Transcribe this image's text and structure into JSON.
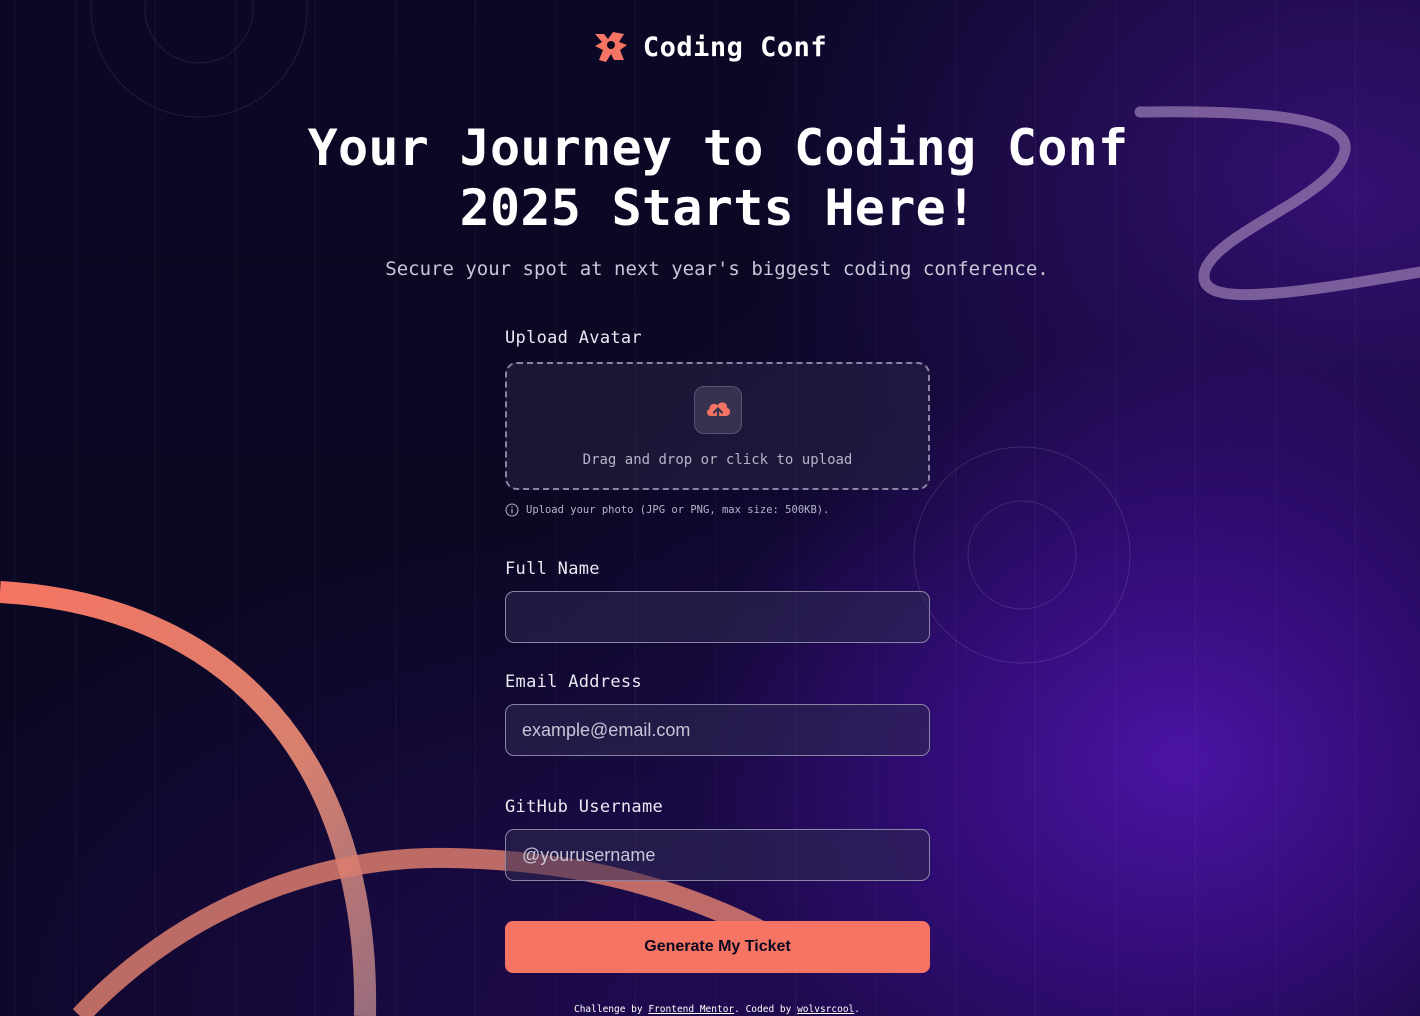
{
  "brand": {
    "name": "Coding Conf"
  },
  "hero": {
    "title": "Your Journey to Coding Conf 2025 Starts Here!",
    "subtitle": "Secure your spot at next year's biggest coding conference."
  },
  "form": {
    "avatar": {
      "label": "Upload Avatar",
      "dropzone_text": "Drag and drop or click to upload",
      "hint": "Upload your photo (JPG or PNG, max size: 500KB)."
    },
    "full_name": {
      "label": "Full Name",
      "value": "",
      "placeholder": ""
    },
    "email": {
      "label": "Email Address",
      "value": "",
      "placeholder": "example@email.com"
    },
    "github": {
      "label": "GitHub Username",
      "value": "",
      "placeholder": "@yourusername"
    },
    "submit_label": "Generate My Ticket"
  },
  "footer": {
    "prefix": "Challenge by ",
    "link1": "Frontend Mentor",
    "middle": ". Coded by ",
    "link2": "wolvsrcool",
    "suffix": "."
  },
  "colors": {
    "accent": "#f57463",
    "background": "#0a0720",
    "purple_glow": "#4e14aa"
  },
  "icons": [
    "logo-icon",
    "upload-cloud-icon",
    "info-icon"
  ]
}
